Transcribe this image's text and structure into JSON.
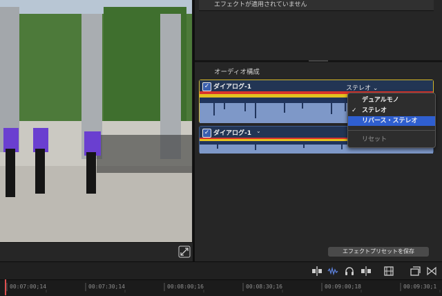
{
  "viewer": {
    "fullscreen_icon": "fullscreen-arrows-icon"
  },
  "inspector": {
    "effects_status": "エフェクトが適用されていません",
    "section_title": "オーディオ構成",
    "rows": [
      {
        "label": "ダイアログ-1",
        "checked": true,
        "mode": "ステレオ",
        "highlighted": true
      },
      {
        "label": "ダイアログ-1",
        "checked": true,
        "highlighted": false
      }
    ],
    "save_preset_label": "エフェクトプリセットを保存"
  },
  "dropdown": {
    "items": [
      {
        "label": "デュアルモノ",
        "checked": false,
        "highlighted": false,
        "enabled": true
      },
      {
        "label": "ステレオ",
        "checked": true,
        "highlighted": false,
        "enabled": true
      },
      {
        "label": "リバース・ステレオ",
        "checked": false,
        "highlighted": true,
        "enabled": true
      },
      {
        "label": "リセット",
        "checked": false,
        "highlighted": false,
        "enabled": false
      }
    ]
  },
  "toolbar": {
    "icons": [
      "clip-skimming-icon",
      "audio-skimming-icon",
      "solo-headphones-icon",
      "snapping-icon",
      "filmstrip-view-icon",
      "clip-appearance-icon",
      "timeline-index-icon"
    ]
  },
  "timeline": {
    "timecodes": [
      "00:07:00;14",
      "00:07:30;14",
      "00:08:00;16",
      "00:08:30;16",
      "00:09:00;18",
      "00:09:30;1"
    ]
  },
  "colors": {
    "accent": "#2f5fd0",
    "selected_border": "#d6b92a",
    "audio_row": "#2b3f62",
    "playhead": "#e05050"
  }
}
